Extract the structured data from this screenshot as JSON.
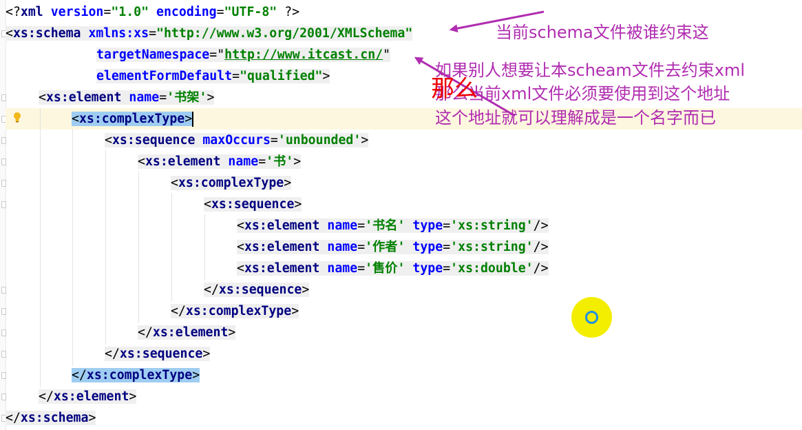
{
  "code_lines": [
    {
      "row": 0,
      "indent": 0,
      "tokens": [
        {
          "c": "punc",
          "t": "<?"
        },
        {
          "c": "tag",
          "t": "xml"
        },
        {
          "c": "punc",
          "t": " "
        },
        {
          "c": "attr",
          "t": "version"
        },
        {
          "c": "punc",
          "t": "="
        },
        {
          "c": "val",
          "t": "\"1.0\""
        },
        {
          "c": "punc",
          "t": " "
        },
        {
          "c": "attr",
          "t": "encoding"
        },
        {
          "c": "punc",
          "t": "="
        },
        {
          "c": "val",
          "t": "\"UTF-8\""
        },
        {
          "c": "punc",
          "t": " ?>"
        }
      ]
    },
    {
      "row": 1,
      "indent": 0,
      "bg": true,
      "tokens": [
        {
          "c": "punc",
          "t": "<"
        },
        {
          "c": "tag",
          "t": "xs:schema"
        },
        {
          "c": "punc",
          "t": " "
        },
        {
          "c": "attr",
          "t": "xmlns:xs"
        },
        {
          "c": "punc",
          "t": "="
        },
        {
          "c": "val",
          "t": "\"http://www.w3.org/2001/XMLSchema\""
        }
      ]
    },
    {
      "row": 2,
      "indent": 11,
      "bg": true,
      "tokens": [
        {
          "c": "attr",
          "t": "targetNamespace"
        },
        {
          "c": "punc",
          "t": "="
        },
        {
          "c": "punc",
          "t": "\""
        },
        {
          "c": "link",
          "t": "http://www.itcast.cn/"
        },
        {
          "c": "punc",
          "t": "\""
        }
      ]
    },
    {
      "row": 3,
      "indent": 11,
      "bg": true,
      "tokens": [
        {
          "c": "attr",
          "t": "elementFormDefault"
        },
        {
          "c": "punc",
          "t": "="
        },
        {
          "c": "val",
          "t": "\"qualified\""
        },
        {
          "c": "punc",
          "t": ">"
        }
      ]
    },
    {
      "row": 4,
      "indent": 4,
      "bg": true,
      "tokens": [
        {
          "c": "punc",
          "t": "<"
        },
        {
          "c": "tag",
          "t": "xs:element"
        },
        {
          "c": "punc",
          "t": " "
        },
        {
          "c": "attr",
          "t": "name"
        },
        {
          "c": "punc",
          "t": "="
        },
        {
          "c": "val",
          "t": "'书架'"
        },
        {
          "c": "punc",
          "t": ">"
        }
      ]
    },
    {
      "row": 5,
      "indent": 8,
      "hl": true,
      "caret": true,
      "tokens": [
        {
          "c": "punc",
          "t": "<"
        },
        {
          "c": "tag",
          "t": "xs:complexType"
        },
        {
          "c": "punc",
          "t": ">"
        }
      ]
    },
    {
      "row": 6,
      "indent": 12,
      "bg": true,
      "tokens": [
        {
          "c": "punc",
          "t": "<"
        },
        {
          "c": "tag",
          "t": "xs:sequence"
        },
        {
          "c": "punc",
          "t": " "
        },
        {
          "c": "attr",
          "t": "maxOccurs"
        },
        {
          "c": "punc",
          "t": "="
        },
        {
          "c": "val",
          "t": "'unbounded'"
        },
        {
          "c": "punc",
          "t": ">"
        }
      ]
    },
    {
      "row": 7,
      "indent": 16,
      "bg": true,
      "tokens": [
        {
          "c": "punc",
          "t": "<"
        },
        {
          "c": "tag",
          "t": "xs:element"
        },
        {
          "c": "punc",
          "t": " "
        },
        {
          "c": "attr",
          "t": "name"
        },
        {
          "c": "punc",
          "t": "="
        },
        {
          "c": "val",
          "t": "'书'"
        },
        {
          "c": "punc",
          "t": ">"
        }
      ]
    },
    {
      "row": 8,
      "indent": 20,
      "bg": true,
      "tokens": [
        {
          "c": "punc",
          "t": "<"
        },
        {
          "c": "tag",
          "t": "xs:complexType"
        },
        {
          "c": "punc",
          "t": ">"
        }
      ]
    },
    {
      "row": 9,
      "indent": 24,
      "bg": true,
      "tokens": [
        {
          "c": "punc",
          "t": "<"
        },
        {
          "c": "tag",
          "t": "xs:sequence"
        },
        {
          "c": "punc",
          "t": ">"
        }
      ]
    },
    {
      "row": 10,
      "indent": 28,
      "bg": true,
      "tokens": [
        {
          "c": "punc",
          "t": "<"
        },
        {
          "c": "tag",
          "t": "xs:element"
        },
        {
          "c": "punc",
          "t": " "
        },
        {
          "c": "attr",
          "t": "name"
        },
        {
          "c": "punc",
          "t": "="
        },
        {
          "c": "val",
          "t": "'书名'"
        },
        {
          "c": "punc",
          "t": " "
        },
        {
          "c": "attr",
          "t": "type"
        },
        {
          "c": "punc",
          "t": "="
        },
        {
          "c": "val",
          "t": "'xs:string'"
        },
        {
          "c": "punc",
          "t": "/>"
        }
      ]
    },
    {
      "row": 11,
      "indent": 28,
      "bg": true,
      "tokens": [
        {
          "c": "punc",
          "t": "<"
        },
        {
          "c": "tag",
          "t": "xs:element"
        },
        {
          "c": "punc",
          "t": " "
        },
        {
          "c": "attr",
          "t": "name"
        },
        {
          "c": "punc",
          "t": "="
        },
        {
          "c": "val",
          "t": "'作者'"
        },
        {
          "c": "punc",
          "t": " "
        },
        {
          "c": "attr",
          "t": "type"
        },
        {
          "c": "punc",
          "t": "="
        },
        {
          "c": "val",
          "t": "'xs:string'"
        },
        {
          "c": "punc",
          "t": "/>"
        }
      ]
    },
    {
      "row": 12,
      "indent": 28,
      "bg": true,
      "tokens": [
        {
          "c": "punc",
          "t": "<"
        },
        {
          "c": "tag",
          "t": "xs:element"
        },
        {
          "c": "punc",
          "t": " "
        },
        {
          "c": "attr",
          "t": "name"
        },
        {
          "c": "punc",
          "t": "="
        },
        {
          "c": "val",
          "t": "'售价'"
        },
        {
          "c": "punc",
          "t": " "
        },
        {
          "c": "attr",
          "t": "type"
        },
        {
          "c": "punc",
          "t": "="
        },
        {
          "c": "val",
          "t": "'xs:double'"
        },
        {
          "c": "punc",
          "t": "/>"
        }
      ]
    },
    {
      "row": 13,
      "indent": 24,
      "bg": true,
      "tokens": [
        {
          "c": "punc",
          "t": "</"
        },
        {
          "c": "tag",
          "t": "xs:sequence"
        },
        {
          "c": "punc",
          "t": ">"
        }
      ]
    },
    {
      "row": 14,
      "indent": 20,
      "bg": true,
      "tokens": [
        {
          "c": "punc",
          "t": "</"
        },
        {
          "c": "tag",
          "t": "xs:complexType"
        },
        {
          "c": "punc",
          "t": ">"
        }
      ]
    },
    {
      "row": 15,
      "indent": 16,
      "bg": true,
      "tokens": [
        {
          "c": "punc",
          "t": "</"
        },
        {
          "c": "tag",
          "t": "xs:element"
        },
        {
          "c": "punc",
          "t": ">"
        }
      ]
    },
    {
      "row": 16,
      "indent": 12,
      "bg": true,
      "tokens": [
        {
          "c": "punc",
          "t": "</"
        },
        {
          "c": "tag",
          "t": "xs:sequence"
        },
        {
          "c": "punc",
          "t": ">"
        }
      ]
    },
    {
      "row": 17,
      "indent": 8,
      "hl": true,
      "tokens": [
        {
          "c": "punc",
          "t": "</"
        },
        {
          "c": "tag",
          "t": "xs:complexType"
        },
        {
          "c": "punc",
          "t": ">"
        }
      ]
    },
    {
      "row": 18,
      "indent": 4,
      "bg": true,
      "tokens": [
        {
          "c": "punc",
          "t": "</"
        },
        {
          "c": "tag",
          "t": "xs:element"
        },
        {
          "c": "punc",
          "t": ">"
        }
      ]
    },
    {
      "row": 19,
      "indent": 0,
      "bg": true,
      "tokens": [
        {
          "c": "punc",
          "t": "</"
        },
        {
          "c": "tag",
          "t": "xs:schema"
        },
        {
          "c": "punc",
          "t": ">"
        }
      ]
    }
  ],
  "annotations": {
    "note1": "当前schema文件被谁约束这",
    "note2": "如果别人想要让本scheam文件去约束xml",
    "note3": "那么当前xml文件必须要使用到这个地址",
    "note4": "这个地址就可以理解成是一个名字而已",
    "red_mark": "那么"
  },
  "icons": {
    "gutter_hint": "lightbulb-icon",
    "cursor": "mouse-cursor-highlight-icon"
  },
  "colors": {
    "tag": "#000080",
    "attribute": "#0000ff",
    "value": "#008000",
    "annotation": "#b02cb0",
    "red_mark": "#f00000",
    "selection": "#9fcdf2",
    "current_line": "#fdf7df",
    "cursor_ring": "#f3ed00"
  }
}
